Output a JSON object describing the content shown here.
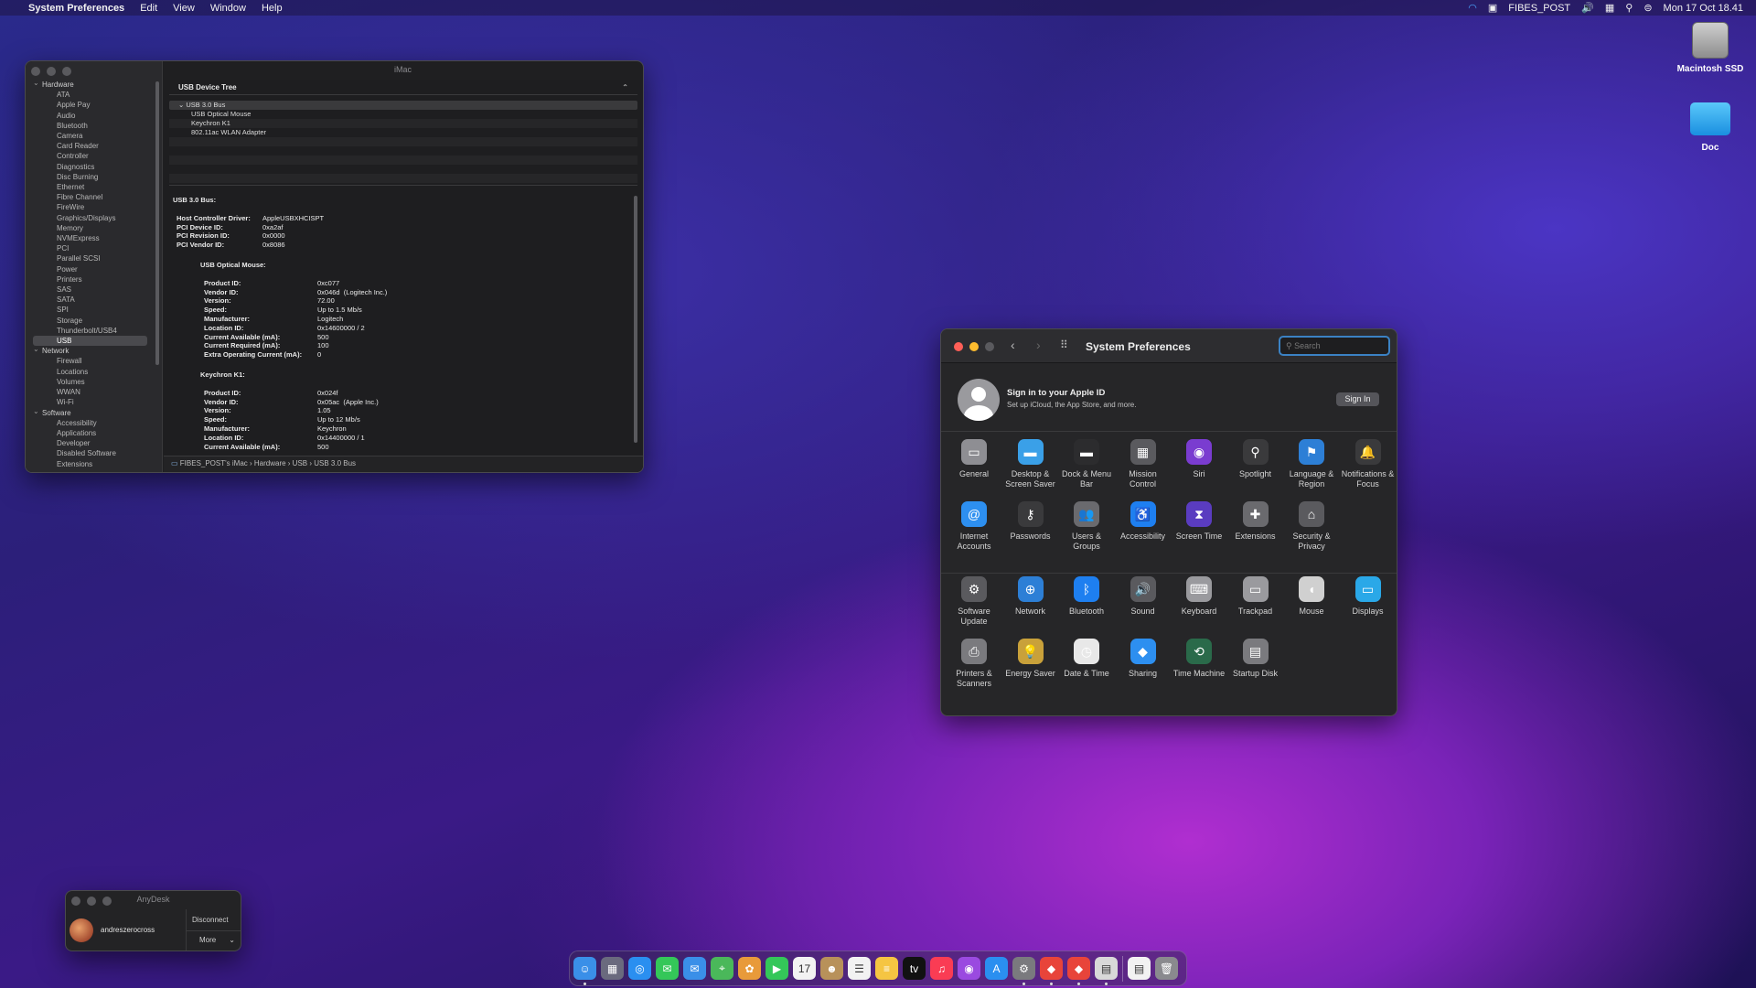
{
  "menubar": {
    "app": "System Preferences",
    "items": [
      "Edit",
      "View",
      "Window",
      "Help"
    ],
    "network_name": "FIBES_POST",
    "clock": "Mon 17 Oct 18.41"
  },
  "desktop": [
    {
      "label": "Macintosh SSD",
      "icon": "drive-icon"
    },
    {
      "label": "Doc",
      "icon": "folder-icon"
    }
  ],
  "sysinfo": {
    "title": "iMac",
    "tree": [
      {
        "cat": "Hardware",
        "items": [
          "ATA",
          "Apple Pay",
          "Audio",
          "Bluetooth",
          "Camera",
          "Card Reader",
          "Controller",
          "Diagnostics",
          "Disc Burning",
          "Ethernet",
          "Fibre Channel",
          "FireWire",
          "Graphics/Displays",
          "Memory",
          "NVMExpress",
          "PCI",
          "Parallel SCSI",
          "Power",
          "Printers",
          "SAS",
          "SATA",
          "SPI",
          "Storage",
          "Thunderbolt/USB4",
          "USB"
        ]
      },
      {
        "cat": "Network",
        "items": [
          "Firewall",
          "Locations",
          "Volumes",
          "WWAN",
          "Wi-Fi"
        ]
      },
      {
        "cat": "Software",
        "items": [
          "Accessibility",
          "Applications",
          "Developer",
          "Disabled Software",
          "Extensions"
        ]
      }
    ],
    "selected": "USB",
    "section_title": "USB Device Tree",
    "device_tree": [
      "USB 3.0 Bus",
      "USB Optical Mouse",
      "Keychron K1",
      "802.11ac WLAN Adapter"
    ],
    "bus_title": "USB 3.0 Bus:",
    "bus_kv": [
      [
        "Host Controller Driver:",
        "AppleUSBXHCISPT"
      ],
      [
        "PCI Device ID:",
        "0xa2af"
      ],
      [
        "PCI Revision ID:",
        "0x0000"
      ],
      [
        "PCI Vendor ID:",
        "0x8086"
      ]
    ],
    "mouse_title": "USB Optical Mouse:",
    "mouse_kv": [
      [
        "Product ID:",
        "0xc077"
      ],
      [
        "Vendor ID:",
        "0x046d  (Logitech Inc.)"
      ],
      [
        "Version:",
        "72.00"
      ],
      [
        "Speed:",
        "Up to 1.5 Mb/s"
      ],
      [
        "Manufacturer:",
        "Logitech"
      ],
      [
        "Location ID:",
        "0x14600000 / 2"
      ],
      [
        "Current Available (mA):",
        "500"
      ],
      [
        "Current Required (mA):",
        "100"
      ],
      [
        "Extra Operating Current (mA):",
        "0"
      ]
    ],
    "kb_title": "Keychron K1:",
    "kb_kv": [
      [
        "Product ID:",
        "0x024f"
      ],
      [
        "Vendor ID:",
        "0x05ac  (Apple Inc.)"
      ],
      [
        "Version:",
        "1.05"
      ],
      [
        "Speed:",
        "Up to 12 Mb/s"
      ],
      [
        "Manufacturer:",
        "Keychron"
      ],
      [
        "Location ID:",
        "0x14400000 / 1"
      ],
      [
        "Current Available (mA):",
        "500"
      ]
    ],
    "path": "FIBES_POST's iMac › Hardware › USB › USB 3.0 Bus"
  },
  "prefs": {
    "title": "System Preferences",
    "search_placeholder": "Search",
    "signin_title": "Sign in to your Apple ID",
    "signin_sub": "Set up iCloud, the App Store, and more.",
    "signin_button": "Sign In",
    "items": [
      {
        "label": "General",
        "icon": "general-icon",
        "color": "#8e8e93",
        "glyph": "▭"
      },
      {
        "label": "Desktop & Screen Saver",
        "icon": "desktop-icon",
        "color": "#3aa0e8",
        "glyph": "▬"
      },
      {
        "label": "Dock & Menu Bar",
        "icon": "dock-icon",
        "color": "#2c2c2e",
        "glyph": "▬"
      },
      {
        "label": "Mission Control",
        "icon": "mission-control-icon",
        "color": "#5a5a5e",
        "glyph": "▦"
      },
      {
        "label": "Siri",
        "icon": "siri-icon",
        "color": "#7a3cd0",
        "glyph": "◉"
      },
      {
        "label": "Spotlight",
        "icon": "spotlight-icon",
        "color": "#3a3a3c",
        "glyph": "⚲"
      },
      {
        "label": "Language & Region",
        "icon": "globe-flag-icon",
        "color": "#2d7fd6",
        "glyph": "⚑"
      },
      {
        "label": "Notifications & Focus",
        "icon": "bell-icon",
        "color": "#3a3a3c",
        "glyph": "🔔"
      },
      {
        "label": "Internet Accounts",
        "icon": "at-icon",
        "color": "#2d8ff0",
        "glyph": "@"
      },
      {
        "label": "Passwords",
        "icon": "key-icon",
        "color": "#3a3a3c",
        "glyph": "⚷"
      },
      {
        "label": "Users & Groups",
        "icon": "users-icon",
        "color": "#6a6a6e",
        "glyph": "👥"
      },
      {
        "label": "Accessibility",
        "icon": "accessibility-icon",
        "color": "#1e7ff0",
        "glyph": "♿"
      },
      {
        "label": "Screen Time",
        "icon": "hourglass-icon",
        "color": "#5a3cc0",
        "glyph": "⧗"
      },
      {
        "label": "Extensions",
        "icon": "puzzle-icon",
        "color": "#6a6a6e",
        "glyph": "✚"
      },
      {
        "label": "Security & Privacy",
        "icon": "house-lock-icon",
        "color": "#5a5a5e",
        "glyph": "⌂"
      },
      {
        "label": "Software Update",
        "icon": "gear-update-icon",
        "color": "#5a5a5e",
        "glyph": "⚙"
      },
      {
        "label": "Network",
        "icon": "network-globe-icon",
        "color": "#2d7fd6",
        "glyph": "⊕"
      },
      {
        "label": "Bluetooth",
        "icon": "bluetooth-icon",
        "color": "#1e7ff0",
        "glyph": "ᛒ"
      },
      {
        "label": "Sound",
        "icon": "speaker-icon",
        "color": "#5a5a5e",
        "glyph": "🔊"
      },
      {
        "label": "Keyboard",
        "icon": "keyboard-icon",
        "color": "#9a9a9e",
        "glyph": "⌨"
      },
      {
        "label": "Trackpad",
        "icon": "trackpad-icon",
        "color": "#9a9a9e",
        "glyph": "▭"
      },
      {
        "label": "Mouse",
        "icon": "mouse-icon",
        "color": "#d0d0d0",
        "glyph": "◖"
      },
      {
        "label": "Displays",
        "icon": "display-icon",
        "color": "#2aa8e8",
        "glyph": "▭"
      },
      {
        "label": "Printers & Scanners",
        "icon": "printer-icon",
        "color": "#7a7a7e",
        "glyph": "⎙"
      },
      {
        "label": "Energy Saver",
        "icon": "bulb-icon",
        "color": "#c9a13a",
        "glyph": "💡"
      },
      {
        "label": "Date & Time",
        "icon": "clock-icon",
        "color": "#e8e8e8",
        "glyph": "◷"
      },
      {
        "label": "Sharing",
        "icon": "sharing-folder-icon",
        "color": "#2d8ff0",
        "glyph": "◆"
      },
      {
        "label": "Time Machine",
        "icon": "time-machine-icon",
        "color": "#2a6a4a",
        "glyph": "⟲"
      },
      {
        "label": "Startup Disk",
        "icon": "disk-icon",
        "color": "#7a7a7e",
        "glyph": "▤"
      }
    ]
  },
  "anydesk": {
    "title": "AnyDesk",
    "user": "andreszerocross",
    "disconnect": "Disconnect",
    "more": "More"
  },
  "dock": [
    {
      "icon": "finder-icon",
      "color": "#3a8fe8",
      "g": "☺",
      "dot": true
    },
    {
      "icon": "launchpad-icon",
      "color": "#6a6a7e",
      "g": "▦"
    },
    {
      "icon": "safari-icon",
      "color": "#2a8ff0",
      "g": "◎"
    },
    {
      "icon": "messages-icon",
      "color": "#34c759",
      "g": "✉"
    },
    {
      "icon": "mail-icon",
      "color": "#3a8fe8",
      "g": "✉"
    },
    {
      "icon": "maps-icon",
      "color": "#4ab85a",
      "g": "⌖"
    },
    {
      "icon": "photos-icon",
      "color": "#e89a3a",
      "g": "✿"
    },
    {
      "icon": "facetime-icon",
      "color": "#34c759",
      "g": "▶"
    },
    {
      "icon": "calendar-icon",
      "color": "#f2f2f2",
      "g": "17"
    },
    {
      "icon": "contacts-icon",
      "color": "#b8915a",
      "g": "☻"
    },
    {
      "icon": "reminders-icon",
      "color": "#f2f2f2",
      "g": "☰"
    },
    {
      "icon": "notes-icon",
      "color": "#f5c542",
      "g": "≡"
    },
    {
      "icon": "tv-icon",
      "color": "#111",
      "g": "tv"
    },
    {
      "icon": "music-icon",
      "color": "#fa3c54",
      "g": "♫"
    },
    {
      "icon": "podcasts-icon",
      "color": "#9a4ae0",
      "g": "◉"
    },
    {
      "icon": "app-store-icon",
      "color": "#2a8ff0",
      "g": "A"
    },
    {
      "icon": "system-preferences-icon",
      "color": "#7a7a7e",
      "g": "⚙",
      "dot": true
    },
    {
      "icon": "anydesk-icon",
      "color": "#e8443a",
      "g": "◆",
      "dot": true
    },
    {
      "icon": "anydesk-alt-icon",
      "color": "#e8443a",
      "g": "◆",
      "dot": true
    },
    {
      "icon": "system-information-icon",
      "color": "#d8d8d8",
      "g": "▤",
      "dot": true
    },
    {
      "icon": "document-icon",
      "color": "#f2f2f2",
      "g": "▤"
    },
    {
      "icon": "trash-icon",
      "color": "#8a8a8e",
      "g": "🗑"
    }
  ]
}
